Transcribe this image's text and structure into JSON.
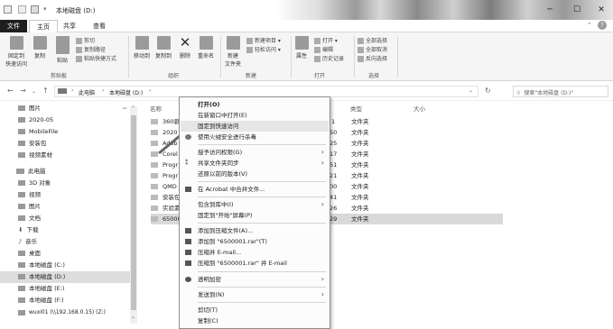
{
  "window": {
    "title": "本地磁盘 (D:)",
    "minimize": "─",
    "maximize": "☐",
    "close": "✕",
    "help": "?"
  },
  "ribbon_tabs": [
    "文件",
    "主页",
    "共享",
    "查看"
  ],
  "ribbon": {
    "pin": "固定到\n快速访问",
    "copy": "复制",
    "paste": "粘贴",
    "cut": "剪切",
    "copy_path": "复制路径",
    "paste_shortcut": "粘贴快捷方式",
    "move_to": "移动到",
    "copy_to": "复制到",
    "delete": "删除",
    "rename": "重命名",
    "new_folder": "新建\n文件夹",
    "new_item": "新建项目 ▾",
    "easy_access": "轻松访问 ▾",
    "properties": "属性",
    "open": "打开 ▾",
    "edit": "编辑",
    "history": "历史记录",
    "select_all": "全部选择",
    "select_none": "全部取消",
    "invert": "反向选择",
    "groups": [
      "剪贴板",
      "组织",
      "新建",
      "打开",
      "选择"
    ]
  },
  "address": {
    "path": [
      "此电脑",
      "本地磁盘 (D:)"
    ],
    "search_placeholder": "搜索\"本地磁盘 (D:)\""
  },
  "nav": [
    {
      "label": "图片",
      "pin": "📌"
    },
    {
      "label": "2020-05"
    },
    {
      "label": "MobileFile"
    },
    {
      "label": "安装包"
    },
    {
      "label": "视频素材"
    },
    {
      "label": "此电脑"
    },
    {
      "label": "3D 对象"
    },
    {
      "label": "视频"
    },
    {
      "label": "图片"
    },
    {
      "label": "文档"
    },
    {
      "label": "下载"
    },
    {
      "label": "音乐"
    },
    {
      "label": "桌面"
    },
    {
      "label": "本地磁盘 (C:)"
    },
    {
      "label": "本地磁盘 (D:)"
    },
    {
      "label": "本地磁盘 (E:)"
    },
    {
      "label": "本地磁盘 (F:)"
    },
    {
      "label": "wuxi01 (\\\\192.168.0.15) (Z:)"
    }
  ],
  "columns": {
    "name": "名称",
    "type": "类型",
    "size": "大小"
  },
  "files": [
    {
      "name": "360驱",
      "date": "1",
      "type": "文件夹"
    },
    {
      "name": "2020",
      "date": "50",
      "type": "文件夹"
    },
    {
      "name": "Adob",
      "date": "25",
      "type": "文件夹"
    },
    {
      "name": "Corel",
      "date": "17",
      "type": "文件夹"
    },
    {
      "name": "Progr",
      "date": "51",
      "type": "文件夹"
    },
    {
      "name": "Progr",
      "date": "21",
      "type": "文件夹"
    },
    {
      "name": "QMD",
      "date": "00",
      "type": "文件夹"
    },
    {
      "name": "安装包",
      "date": "41",
      "type": "文件夹"
    },
    {
      "name": "实验素",
      "date": "26",
      "type": "文件夹"
    },
    {
      "name": "65000",
      "date": "29",
      "type": "文件夹"
    }
  ],
  "context_menu": [
    {
      "label": "打开(O)"
    },
    {
      "label": "在新窗口中打开(E)"
    },
    {
      "label": "固定到快速访问"
    },
    {
      "label": "使用火绒安全进行杀毒"
    },
    {
      "label": "授予访问权限(G)"
    },
    {
      "label": "共享文件夹同步"
    },
    {
      "label": "还原以前的版本(V)"
    },
    {
      "label": "在 Acrobat 中合并文件..."
    },
    {
      "label": "包含到库中(I)"
    },
    {
      "label": "固定到\"开始\"屏幕(P)"
    },
    {
      "label": "添加到压缩文件(A)..."
    },
    {
      "label": "添加到 \"6500001.rar\"(T)"
    },
    {
      "label": "压缩并 E-mail..."
    },
    {
      "label": "压缩到 \"6500001.rar\" 并 E-mail"
    },
    {
      "label": "透明加密"
    },
    {
      "label": "发送到(N)"
    },
    {
      "label": "剪切(T)"
    },
    {
      "label": "复制(C)"
    }
  ]
}
